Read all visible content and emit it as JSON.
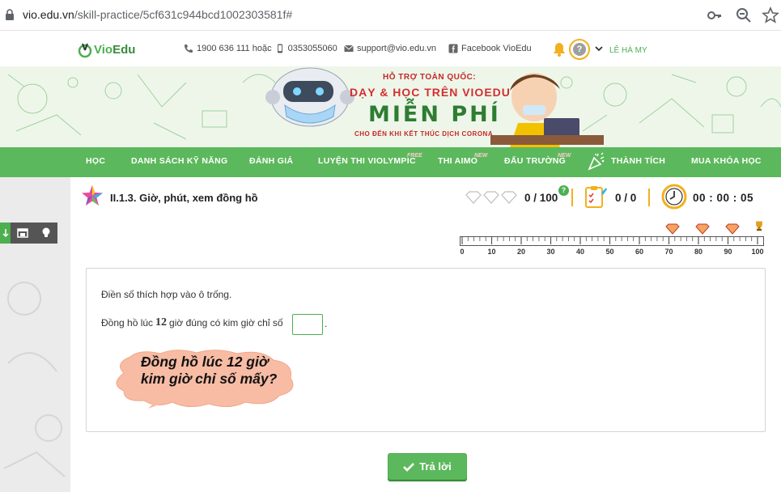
{
  "browser": {
    "url_host": "vio.edu.vn",
    "url_path": "/skill-practice/5cf631c944bcd1002303581f#"
  },
  "header": {
    "logo_text_a": "Vio",
    "logo_text_b": "Edu",
    "phone": "1900 636 111 hoặc",
    "mobile": "0353055060",
    "email": "support@vio.edu.vn",
    "facebook": "Facebook VioEdu",
    "user_name": "LÊ HÀ MY"
  },
  "banner": {
    "line1": "HỖ TRỢ TOÀN QUỐC:",
    "line2": "DẠY & HỌC TRÊN VIOEDU",
    "line3": "MIỄN PHÍ",
    "line4": "CHO ĐẾN KHI KẾT THÚC DỊCH CORONA"
  },
  "nav": {
    "items": [
      {
        "label": "HỌC"
      },
      {
        "label": "DANH SÁCH KỸ NĂNG"
      },
      {
        "label": "ĐÁNH GIÁ"
      },
      {
        "label": "LUYỆN THI VIOLYMPIC"
      },
      {
        "label": "THI AIMO"
      },
      {
        "label": "ĐẤU TRƯỜNG"
      },
      {
        "label": "THÀNH TÍCH"
      },
      {
        "label": "MUA KHÓA HỌC"
      }
    ],
    "badge_free": "FREE",
    "badge_new_1": "NEW",
    "badge_new_2": "NEW"
  },
  "practice": {
    "skill_title": "II.1.3. Giờ, phút, xem đồng hồ",
    "score": "0 / 100",
    "help": "?",
    "answered": "0 / 0",
    "timer": "00 : 00 : 05",
    "progress": 0,
    "ruler_ticks": [
      "0",
      "10",
      "20",
      "30",
      "40",
      "50",
      "60",
      "70",
      "80",
      "90",
      "100"
    ]
  },
  "question": {
    "instruction": "Điền số thích hợp vào ô trống.",
    "text_before": "Đồng hồ lúc",
    "number": "12",
    "text_after": "giờ đúng có kim giờ chỉ số",
    "answer_value": "",
    "trailing": ".",
    "hint_line1": "Đồng hồ lúc 12 giờ",
    "hint_line2": "kim giờ chỉ số mấy?"
  },
  "actions": {
    "submit_label": "Trả lời"
  },
  "colors": {
    "brand_green": "#5cb85c",
    "accent_orange": "#f2b01e"
  }
}
